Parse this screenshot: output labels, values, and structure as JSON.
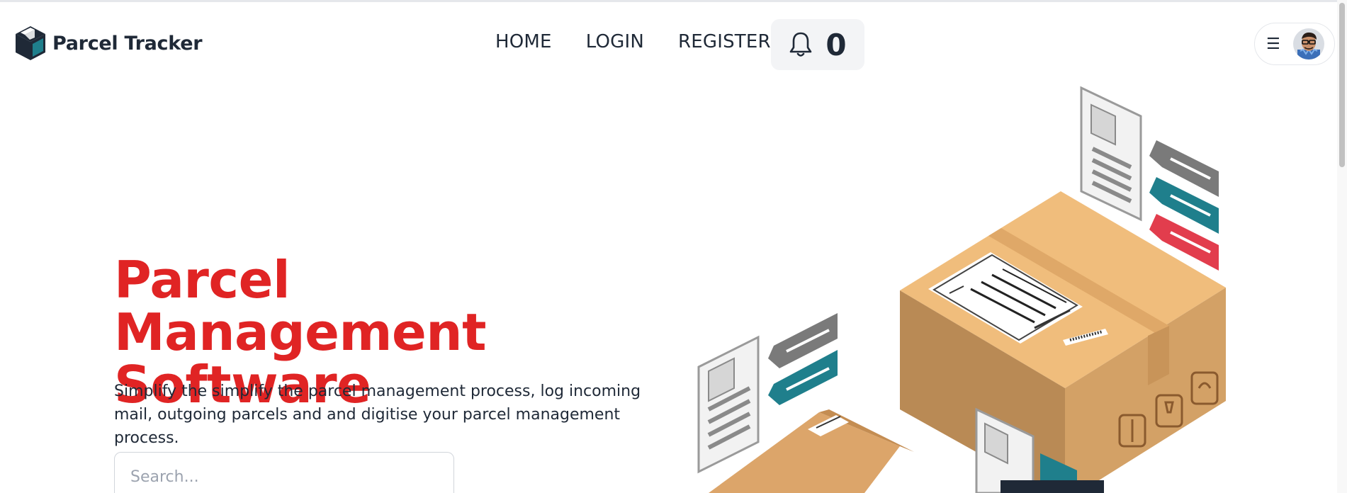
{
  "brand": {
    "name": "Parcel Tracker"
  },
  "nav": {
    "items": [
      {
        "label": "HOME"
      },
      {
        "label": "LOGIN"
      },
      {
        "label": "REGISTER"
      }
    ]
  },
  "notifications": {
    "count": "0"
  },
  "user_menu": {
    "menu_icon": "☰"
  },
  "hero": {
    "title_line1": "Parcel Management",
    "title_line2": "Software",
    "description_line1": "Simplify the simplify the parcel management process, log incoming",
    "description_line2": "mail, outgoing parcels and and digitise your parcel management process."
  },
  "search": {
    "placeholder": "Search..."
  },
  "colors": {
    "accent_red": "#e02424",
    "text_dark": "#1f2937",
    "teal": "#1f7f8c",
    "box_tan": "#d8a96b"
  }
}
